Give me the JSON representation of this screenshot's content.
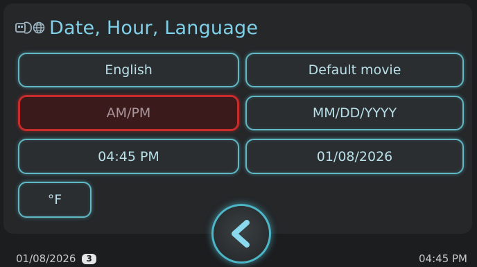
{
  "header": {
    "title": "Date, Hour, Language",
    "icons": [
      "display-icon",
      "globe-icon"
    ]
  },
  "settings": {
    "language": "English",
    "movie": "Default movie",
    "time_format": "AM/PM",
    "date_format": "MM/DD/YYYY",
    "time": "04:45 PM",
    "date": "01/08/2026",
    "temp_unit": "°F",
    "selected": "time_format"
  },
  "back_button": {
    "icon": "chevron-left-icon"
  },
  "footer": {
    "date": "01/08/2026",
    "badge": "3",
    "time": "04:45 PM"
  },
  "colors": {
    "accent": "#5fb8c4",
    "title": "#7fd0e8",
    "selected_border": "#c72b2b",
    "background": "#1c1d1f"
  }
}
